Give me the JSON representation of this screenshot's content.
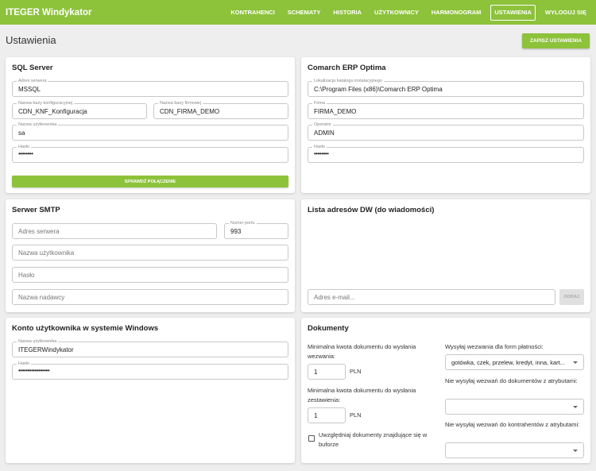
{
  "app": {
    "title": "ITEGER Windykator"
  },
  "nav": {
    "items": [
      "KONTRAHENCI",
      "SCHEMATY",
      "HISTORIA",
      "UŻYTKOWNICY",
      "HARMONOGRAM",
      "USTAWIENIA",
      "WYLOGUJ SIĘ"
    ],
    "active": "USTAWIENIA"
  },
  "page": {
    "title": "Ustawienia",
    "save_label": "ZAPISZ USTAWIENIA"
  },
  "sql": {
    "title": "SQL Server",
    "server_label": "Adres serwera",
    "server_value": "MSSQL",
    "config_db_label": "Nazwa bazy konfiguracyjnej",
    "config_db_value": "CDN_KNF_Konfiguracja",
    "company_db_label": "Nazwa bazy firmowej",
    "company_db_value": "CDN_FIRMA_DEMO",
    "user_label": "Nazwa użytkownika",
    "user_value": "sa",
    "password_label": "Hasło",
    "password_value": "••••••••",
    "check_label": "SPRAWDŹ POŁĄCZENIE"
  },
  "optima": {
    "title": "Comarch ERP Optima",
    "path_label": "Lokalizacja katalogu instalacyjnego",
    "path_value": "C:\\Program Files (x86)\\Comarch ERP Optima",
    "company_label": "Firma",
    "company_value": "FIRMA_DEMO",
    "operator_label": "Operator",
    "operator_value": "ADMIN",
    "password_label": "Hasło",
    "password_value": "••••••••"
  },
  "smtp": {
    "title": "Serwer SMTP",
    "server_placeholder": "Adres serwera",
    "port_label": "Numer portu",
    "port_value": "993",
    "user_placeholder": "Nazwa użytkownika",
    "password_placeholder": "Hasło",
    "sender_placeholder": "Nazwa nadawcy"
  },
  "dw": {
    "title": "Lista adresów DW (do wiadomości)",
    "email_placeholder": "Adres e-mail...",
    "add_label": "DODAJ"
  },
  "windows": {
    "title": "Konto użytkownika w systemie Windows",
    "user_label": "Nazwa użytkownika",
    "user_value": "ITEGERWindykator",
    "password_label": "Hasło",
    "password_value": "•••••••••••••••••"
  },
  "docs": {
    "title": "Dokumenty",
    "min_call_label": "Minimalna kwota dokumentu do wysłania wezwania:",
    "min_call_value": "1",
    "min_stmt_label": "Minimalna kwota dokumentu do wysłania zestawienia:",
    "min_stmt_value": "1",
    "currency": "PLN",
    "buffer_label": "Uwzględniaj dokumenty znajdujące się w buforze",
    "payment_forms_label": "Wysyłaj wezwania dla form płatności:",
    "payment_forms_value": "gotówka, czek, przelew, kredyt, inna, kart...",
    "exclude_docs_label": "Nie wysyłaj wezwań do dokumentów z atrybutami:",
    "exclude_contractors_label": "Nie wysyłaj wezwań do kontrahentów z atrybutami:"
  },
  "colors": {
    "accent": "#8dc23b",
    "background": "#eeeeee",
    "card": "#ffffff"
  }
}
